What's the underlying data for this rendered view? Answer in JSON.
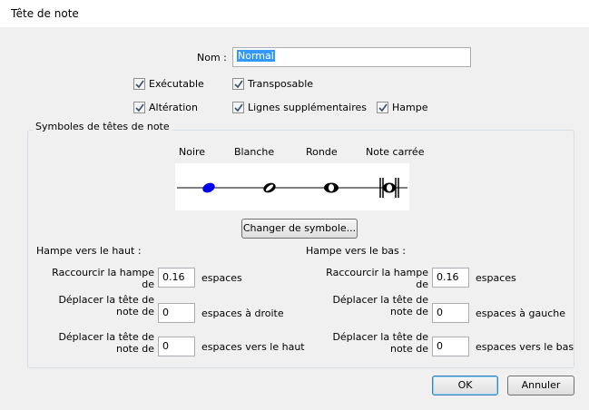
{
  "window": {
    "title": "Tête de note"
  },
  "name_field": {
    "label": "Nom :",
    "value": "Normal"
  },
  "checkboxes": {
    "executable": {
      "label": "Exécutable",
      "checked": true
    },
    "transposable": {
      "label": "Transposable",
      "checked": true
    },
    "alteration": {
      "label": "Altération",
      "checked": true
    },
    "ledger_lines": {
      "label": "Lignes supplémentaires",
      "checked": true
    },
    "stem": {
      "label": "Hampe",
      "checked": true
    }
  },
  "symbols_group": {
    "title": "Symboles de têtes de note",
    "columns": [
      "Noire",
      "Blanche",
      "Ronde",
      "Note carrée"
    ],
    "change_button": "Changer de symbole..."
  },
  "stem_up": {
    "title": "Hampe vers le haut :",
    "rows": [
      {
        "label_line1": "Raccourcir la hampe",
        "label_line2": "de",
        "value": "0.16",
        "unit": "espaces"
      },
      {
        "label_line1": "Déplacer la tête de",
        "label_line2": "note de",
        "value": "0",
        "unit": "espaces à droite"
      },
      {
        "label_line1": "Déplacer la tête de",
        "label_line2": "note de",
        "value": "0",
        "unit": "espaces vers le haut"
      }
    ]
  },
  "stem_down": {
    "title": "Hampe vers le bas :",
    "rows": [
      {
        "label_line1": "Raccourcir la hampe",
        "label_line2": "de",
        "value": "0.16",
        "unit": "espaces"
      },
      {
        "label_line1": "Déplacer la tête de",
        "label_line2": "note de",
        "value": "0",
        "unit": "espaces à gauche"
      },
      {
        "label_line1": "Déplacer la tête de",
        "label_line2": "note de",
        "value": "0",
        "unit": "espaces vers le bas"
      }
    ]
  },
  "buttons": {
    "ok": "OK",
    "cancel": "Annuler"
  },
  "colors": {
    "selected_notehead": "#0000ee",
    "text_selection": "#3399ff"
  }
}
